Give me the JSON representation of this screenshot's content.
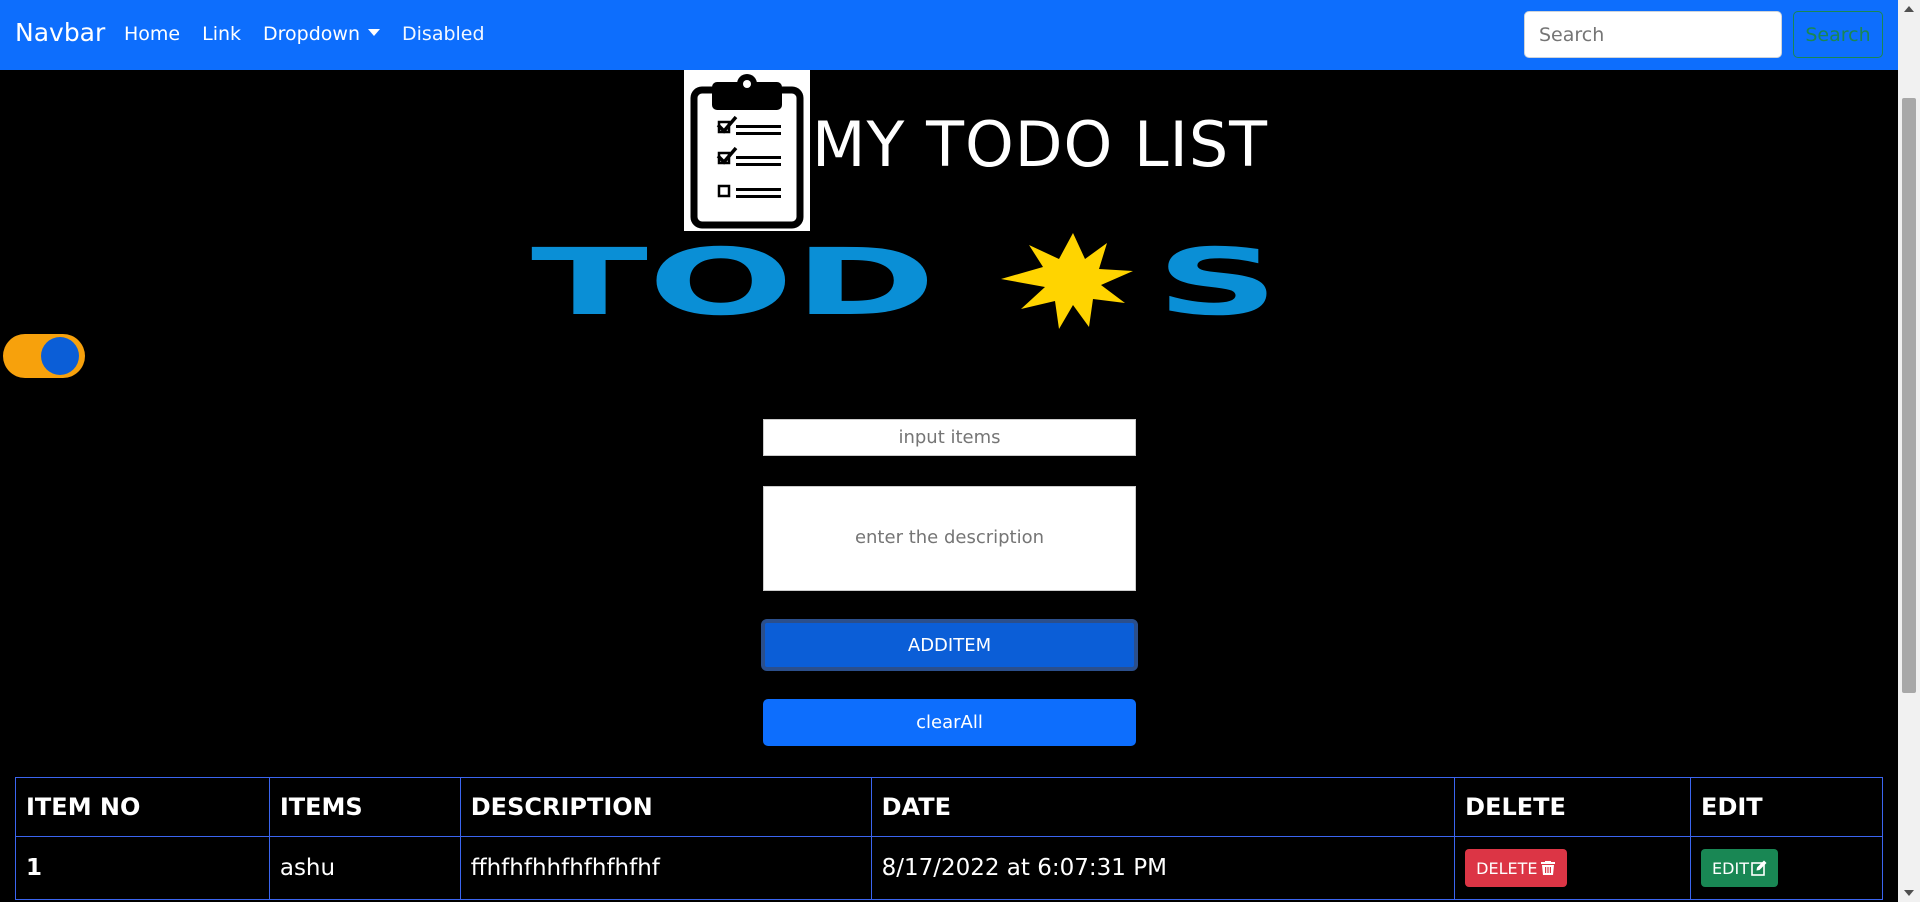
{
  "navbar": {
    "brand": "Navbar",
    "links": [
      "Home",
      "Link",
      "Dropdown",
      "Disabled"
    ],
    "search_placeholder": "Search",
    "search_button": "Search"
  },
  "header": {
    "title": "MY TODO LIST",
    "logo_text": "TODOS"
  },
  "theme_toggle": {
    "state": "on"
  },
  "form": {
    "item_placeholder": "input items",
    "description_placeholder": "enter the description",
    "add_label": "ADDITEM",
    "clear_label": "clearAll"
  },
  "table": {
    "headers": [
      "ITEM NO",
      "ITEMS",
      "DESCRIPTION",
      "DATE",
      "DELETE",
      "EDIT"
    ],
    "rows": [
      {
        "no": "1",
        "item": "ashu",
        "description": "ffhfhfhhfhfhfhfhf",
        "date": "8/17/2022 at 6:07:31 PM",
        "delete_label": "DELETE",
        "edit_label": "EDIT"
      }
    ]
  },
  "colors": {
    "navbar": "#0d6efd",
    "background": "#000000",
    "toggle_track": "#f7a10c",
    "toggle_knob": "#0b5ed7",
    "delete": "#dc3545",
    "edit": "#198754",
    "logo_blue": "#0a8fd6",
    "logo_sun": "#ffd400"
  },
  "icons": [
    "clipboard-checklist-icon",
    "sun-icon",
    "caret-down-icon",
    "trash-icon",
    "pencil-square-icon"
  ]
}
